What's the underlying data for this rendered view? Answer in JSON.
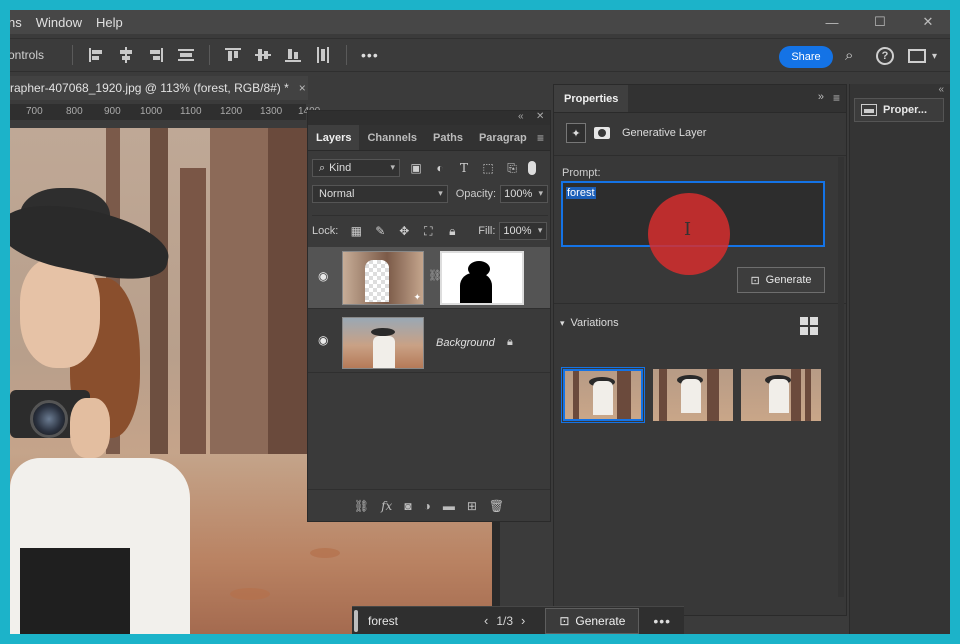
{
  "menu": {
    "items": [
      "ns",
      "Window",
      "Help"
    ]
  },
  "options_bar": {
    "label": "ontrols",
    "share": "Share",
    "more": "•••"
  },
  "document": {
    "tab_title": "rapher-407068_1920.jpg @ 113% (forest, RGB/8#) *",
    "close": "×",
    "ruler_ticks": [
      "700",
      "800",
      "900",
      "1000",
      "1100",
      "1200",
      "1300",
      "1400"
    ]
  },
  "layers_panel": {
    "tabs": [
      "Layers",
      "Channels",
      "Paths",
      "Paragraph"
    ],
    "filter_kind": "Kind",
    "blend_mode": "Normal",
    "opacity_label": "Opacity:",
    "opacity_value": "100%",
    "lock_label": "Lock:",
    "fill_label": "Fill:",
    "fill_value": "100%",
    "layers": [
      {
        "name": "",
        "selected": true,
        "has_mask": true
      },
      {
        "name": "Background",
        "selected": false,
        "locked": true
      }
    ]
  },
  "properties_panel": {
    "tab": "Properties",
    "layer_type": "Generative Layer",
    "prompt_label": "Prompt:",
    "prompt_value": "forest",
    "generate_label": "Generate",
    "variations_label": "Variations",
    "variations_count": 3,
    "selected_variation": 1
  },
  "right_dock": {
    "button_label": "Proper..."
  },
  "context_bar": {
    "prompt": "forest",
    "page": "1/3",
    "generate": "Generate",
    "more": "•••"
  },
  "colors": {
    "accent": "#1473e6",
    "cursor_highlight": "#d62e2e",
    "frame": "#1cb3c9"
  }
}
